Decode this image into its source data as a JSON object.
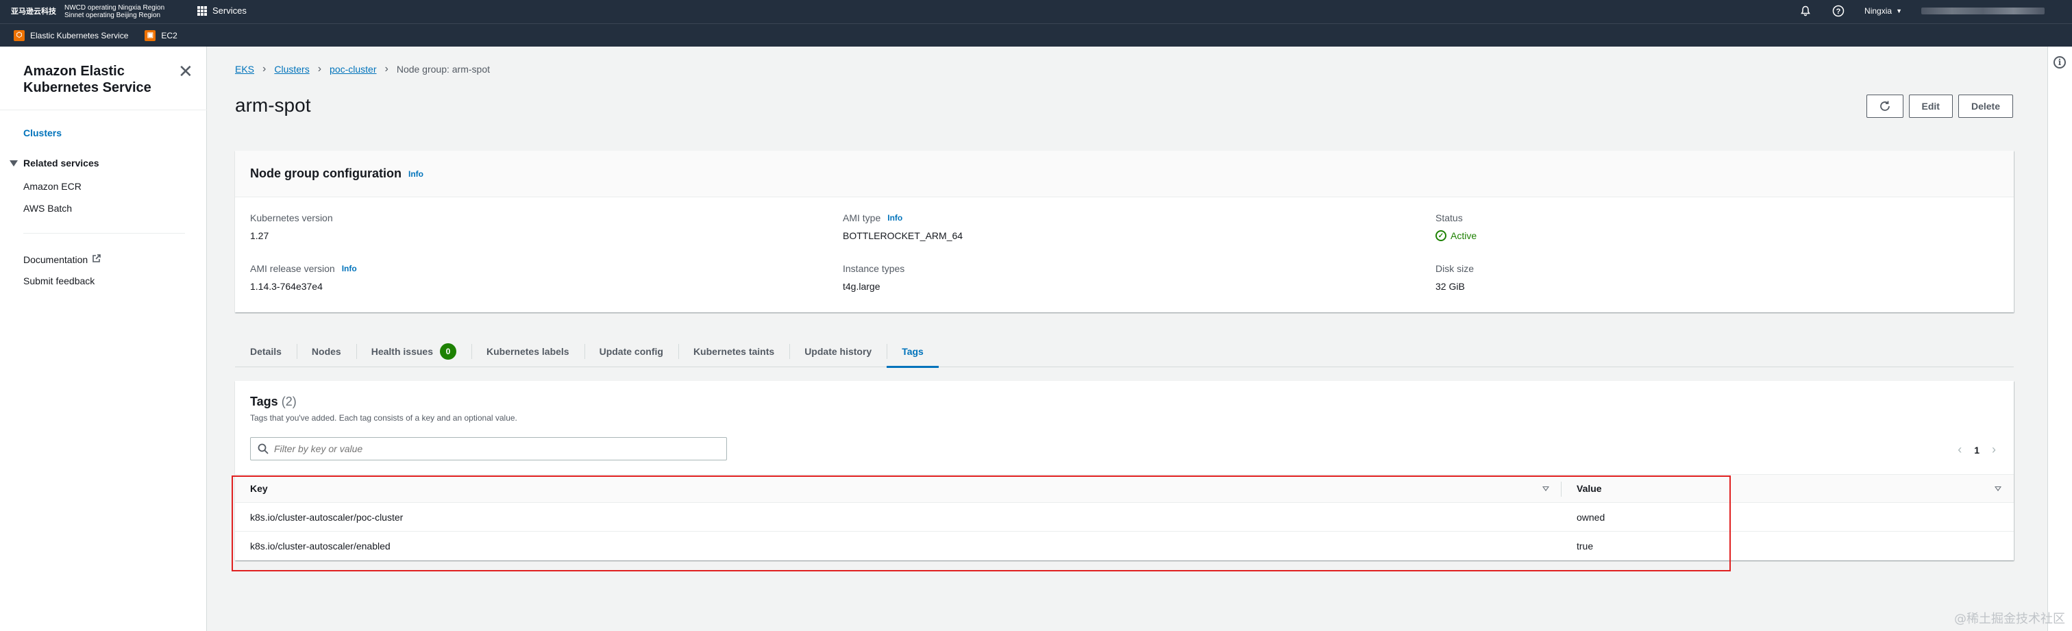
{
  "topnav": {
    "logo_text": "亚马逊云科技",
    "region_line1": "NWCD operating Ningxia Region",
    "region_line2": "Sinnet operating Beijing Region",
    "services_label": "Services",
    "region_selector": "Ningxia",
    "icons": [
      "bell-icon",
      "help-icon"
    ]
  },
  "favorites": [
    {
      "label": "Elastic Kubernetes Service",
      "icon": "eks-icon"
    },
    {
      "label": "EC2",
      "icon": "ec2-icon"
    }
  ],
  "sidebar": {
    "title": "Amazon Elastic Kubernetes Service",
    "items": [
      {
        "label": "Clusters"
      },
      {
        "label": "Related services"
      },
      {
        "label": "Amazon ECR"
      },
      {
        "label": "AWS Batch"
      },
      {
        "label": "Documentation"
      },
      {
        "label": "Submit feedback"
      }
    ]
  },
  "breadcrumb": {
    "eks": "EKS",
    "clusters": "Clusters",
    "cluster": "poc-cluster",
    "current": "Node group: arm-spot"
  },
  "page": {
    "title": "arm-spot",
    "edit_label": "Edit",
    "delete_label": "Delete"
  },
  "config": {
    "header": "Node group configuration",
    "info": "Info",
    "k8s_version_label": "Kubernetes version",
    "k8s_version": "1.27",
    "ami_release_label": "AMI release version",
    "ami_release": "1.14.3-764e37e4",
    "ami_type_label": "AMI type",
    "ami_type": "BOTTLEROCKET_ARM_64",
    "instance_types_label": "Instance types",
    "instance_types": "t4g.large",
    "status_label": "Status",
    "status": "Active",
    "disk_size_label": "Disk size",
    "disk_size": "32 GiB"
  },
  "tabs": [
    {
      "label": "Details"
    },
    {
      "label": "Nodes"
    },
    {
      "label": "Health issues",
      "badge": "0"
    },
    {
      "label": "Kubernetes labels"
    },
    {
      "label": "Update config"
    },
    {
      "label": "Kubernetes taints"
    },
    {
      "label": "Update history"
    },
    {
      "label": "Tags"
    }
  ],
  "tags": {
    "title": "Tags",
    "count": "(2)",
    "description": "Tags that you've added. Each tag consists of a key and an optional value.",
    "filter_placeholder": "Filter by key or value",
    "page": "1",
    "columns": {
      "key": "Key",
      "value": "Value"
    },
    "rows": [
      {
        "key": "k8s.io/cluster-autoscaler/poc-cluster",
        "value": "owned"
      },
      {
        "key": "k8s.io/cluster-autoscaler/enabled",
        "value": "true"
      }
    ]
  },
  "watermark": "@稀土掘金技术社区",
  "colors": {
    "nav_bg": "#232f3e",
    "link": "#0073bb",
    "active_status": "#1d8102",
    "highlight": "#e02020"
  }
}
